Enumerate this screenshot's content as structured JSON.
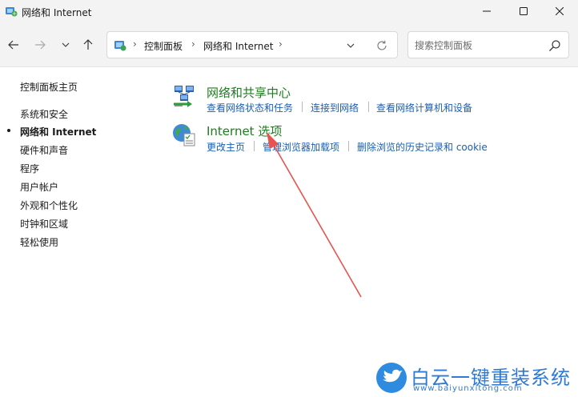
{
  "window": {
    "title": "网络和 Internet"
  },
  "address_bar": {
    "crumbs": [
      "控制面板",
      "网络和 Internet"
    ]
  },
  "search": {
    "placeholder": "搜索控制面板"
  },
  "sidebar": {
    "home": "控制面板主页",
    "items": [
      {
        "label": "系统和安全",
        "active": false
      },
      {
        "label": "网络和 Internet",
        "active": true
      },
      {
        "label": "硬件和声音",
        "active": false
      },
      {
        "label": "程序",
        "active": false
      },
      {
        "label": "用户帐户",
        "active": false
      },
      {
        "label": "外观和个性化",
        "active": false
      },
      {
        "label": "时钟和区域",
        "active": false
      },
      {
        "label": "轻松使用",
        "active": false
      }
    ]
  },
  "categories": [
    {
      "title": "网络和共享中心",
      "icon": "network-sharing-icon",
      "links": [
        "查看网络状态和任务",
        "连接到网络",
        "查看网络计算机和设备"
      ]
    },
    {
      "title": "Internet 选项",
      "icon": "internet-options-icon",
      "links": [
        "更改主页",
        "管理浏览器加载项",
        "删除浏览的历史记录和 cookie"
      ]
    }
  ],
  "watermark": {
    "title": "白云一键重装系统",
    "url": "www.baiyunxitong.com"
  },
  "colors": {
    "category_title": "#1e7d1e",
    "link": "#1a5fb4",
    "annotation_arrow": "#e8534f",
    "watermark": "#2e7ad6"
  }
}
